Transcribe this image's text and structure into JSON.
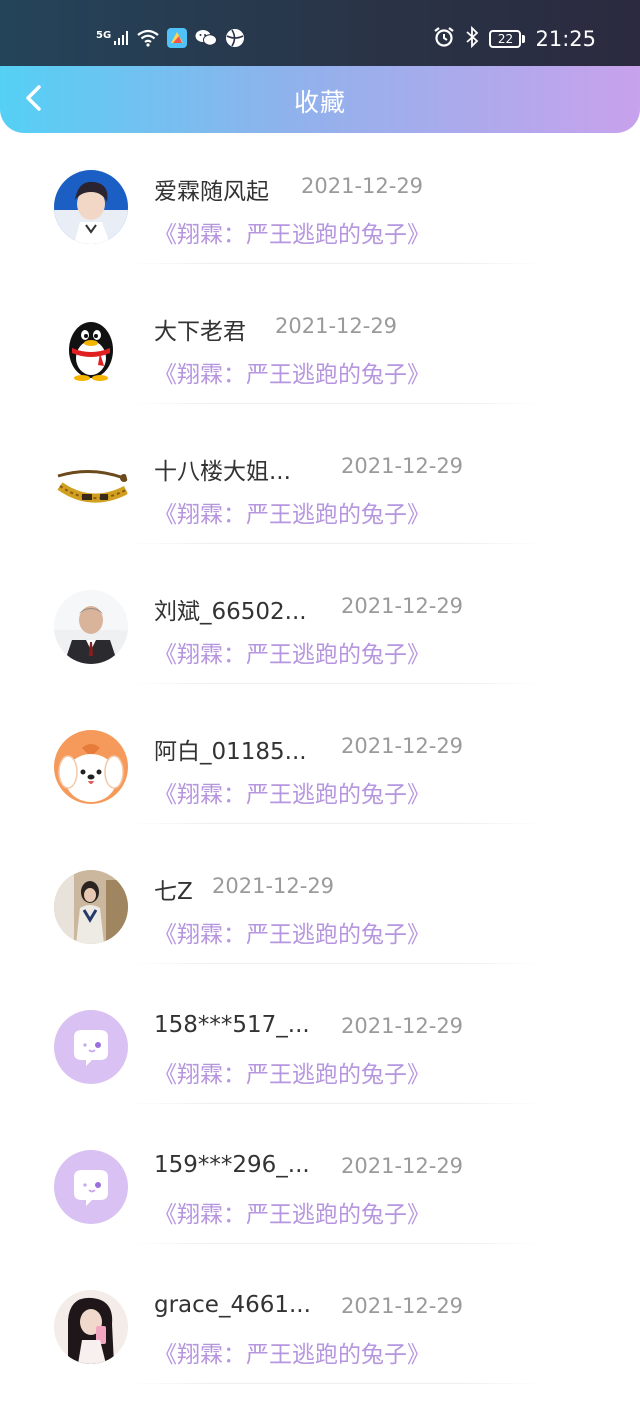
{
  "status_bar": {
    "network": "5G",
    "time": "21:25",
    "battery": "22"
  },
  "header": {
    "title": "收藏"
  },
  "items": [
    {
      "username": "爱霖随风起",
      "date": "2021-12-29",
      "book": "《翔霖：严王逃跑的兔子》",
      "avatar": "avatar-photo-boy"
    },
    {
      "username": "大下老君",
      "date": "2021-12-29",
      "book": "《翔霖：严王逃跑的兔子》",
      "avatar": "avatar-qq-penguin"
    },
    {
      "username": "十八楼大姐...",
      "date": "2021-12-29",
      "book": "《翔霖：严王逃跑的兔子》",
      "avatar": "avatar-bracelet"
    },
    {
      "username": "刘斌_66502...",
      "date": "2021-12-29",
      "book": "《翔霖：严王逃跑的兔子》",
      "avatar": "avatar-photo-man"
    },
    {
      "username": "阿白_01185...",
      "date": "2021-12-29",
      "book": "《翔霖：严王逃跑的兔子》",
      "avatar": "avatar-cartoon-dog"
    },
    {
      "username": "七Z",
      "date": "2021-12-29",
      "book": "《翔霖：严王逃跑的兔子》",
      "avatar": "avatar-photo-girl"
    },
    {
      "username": "158***517_...",
      "date": "2021-12-29",
      "book": "《翔霖：严王逃跑的兔子》",
      "avatar": "avatar-default-chat"
    },
    {
      "username": "159***296_...",
      "date": "2021-12-29",
      "book": "《翔霖：严王逃跑的兔子》",
      "avatar": "avatar-default-chat"
    },
    {
      "username": "grace_4661...",
      "date": "2021-12-29",
      "book": "《翔霖：严王逃跑的兔子》",
      "avatar": "avatar-photo-woman"
    }
  ],
  "colors": {
    "book_title": "#b696df",
    "date": "#9a9a9a",
    "default_avatar_bg": "#d9c2f3"
  }
}
